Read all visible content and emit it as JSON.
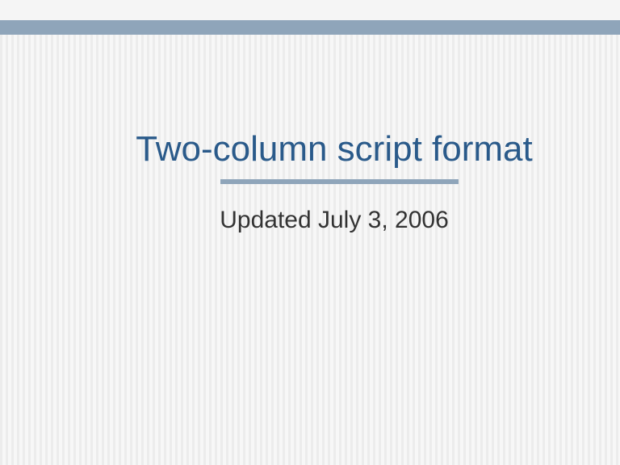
{
  "slide": {
    "title": "Two-column script format",
    "subtitle": "Updated July 3, 2006"
  }
}
